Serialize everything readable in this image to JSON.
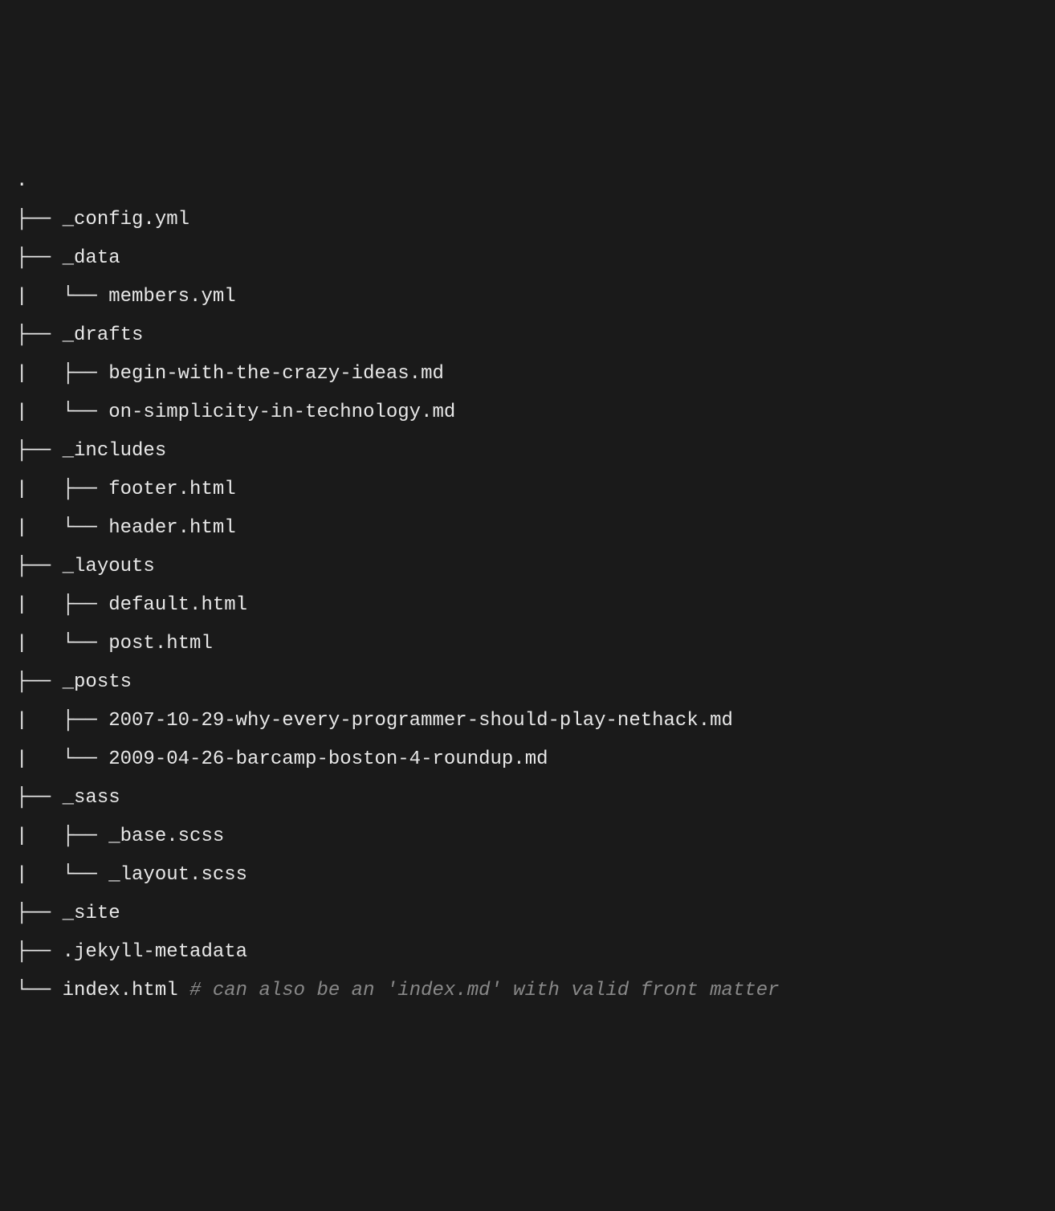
{
  "tree": {
    "root": ".",
    "lines": [
      {
        "prefix": "├── ",
        "name": "_config.yml",
        "comment": ""
      },
      {
        "prefix": "├── ",
        "name": "_data",
        "comment": ""
      },
      {
        "prefix": "|   └── ",
        "name": "members.yml",
        "comment": ""
      },
      {
        "prefix": "├── ",
        "name": "_drafts",
        "comment": ""
      },
      {
        "prefix": "|   ├── ",
        "name": "begin-with-the-crazy-ideas.md",
        "comment": ""
      },
      {
        "prefix": "|   └── ",
        "name": "on-simplicity-in-technology.md",
        "comment": ""
      },
      {
        "prefix": "├── ",
        "name": "_includes",
        "comment": ""
      },
      {
        "prefix": "|   ├── ",
        "name": "footer.html",
        "comment": ""
      },
      {
        "prefix": "|   └── ",
        "name": "header.html",
        "comment": ""
      },
      {
        "prefix": "├── ",
        "name": "_layouts",
        "comment": ""
      },
      {
        "prefix": "|   ├── ",
        "name": "default.html",
        "comment": ""
      },
      {
        "prefix": "|   └── ",
        "name": "post.html",
        "comment": ""
      },
      {
        "prefix": "├── ",
        "name": "_posts",
        "comment": ""
      },
      {
        "prefix": "|   ├── ",
        "name": "2007-10-29-why-every-programmer-should-play-nethack.md",
        "comment": ""
      },
      {
        "prefix": "|   └── ",
        "name": "2009-04-26-barcamp-boston-4-roundup.md",
        "comment": ""
      },
      {
        "prefix": "├── ",
        "name": "_sass",
        "comment": ""
      },
      {
        "prefix": "|   ├── ",
        "name": "_base.scss",
        "comment": ""
      },
      {
        "prefix": "|   └── ",
        "name": "_layout.scss",
        "comment": ""
      },
      {
        "prefix": "├── ",
        "name": "_site",
        "comment": ""
      },
      {
        "prefix": "├── ",
        "name": ".jekyll-metadata",
        "comment": ""
      },
      {
        "prefix": "└── ",
        "name": "index.html",
        "comment": " # can also be an 'index.md' with valid front matter"
      }
    ]
  }
}
